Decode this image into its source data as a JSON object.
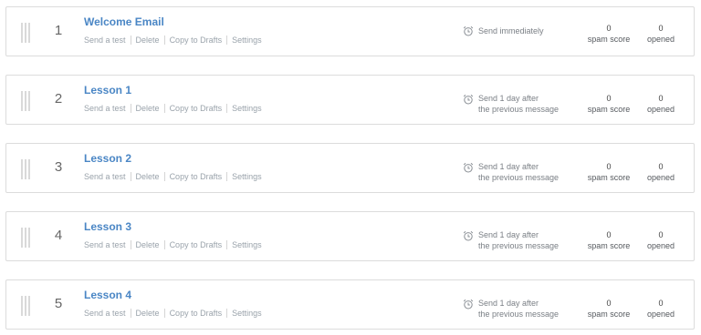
{
  "actions": {
    "send_test": "Send a test",
    "delete": "Delete",
    "copy_to_drafts": "Copy to Drafts",
    "settings": "Settings"
  },
  "stats": {
    "spam_label": "spam score",
    "opened_label": "opened"
  },
  "emails": [
    {
      "number": "1",
      "title": "Welcome Email",
      "schedule_line1": "Send immediately",
      "schedule_line2": "",
      "spam_score": "0",
      "opened": "0"
    },
    {
      "number": "2",
      "title": "Lesson 1",
      "schedule_line1": "Send 1 day after",
      "schedule_line2": "the previous message",
      "spam_score": "0",
      "opened": "0"
    },
    {
      "number": "3",
      "title": "Lesson 2",
      "schedule_line1": "Send 1 day after",
      "schedule_line2": "the previous message",
      "spam_score": "0",
      "opened": "0"
    },
    {
      "number": "4",
      "title": "Lesson 3",
      "schedule_line1": "Send 1 day after",
      "schedule_line2": "the previous message",
      "spam_score": "0",
      "opened": "0"
    },
    {
      "number": "5",
      "title": "Lesson 4",
      "schedule_line1": "Send 1 day after",
      "schedule_line2": "the previous message",
      "spam_score": "0",
      "opened": "0"
    }
  ]
}
